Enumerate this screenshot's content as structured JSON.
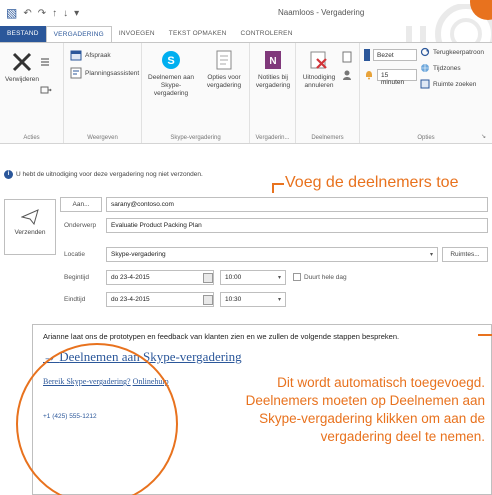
{
  "window": {
    "title": "Naamloos - Vergadering"
  },
  "qat": {
    "icons": [
      "save-icon",
      "undo-icon",
      "redo-icon",
      "up-icon",
      "down-icon",
      "customize-icon"
    ]
  },
  "tabs": [
    {
      "label": "BESTAND",
      "active": false
    },
    {
      "label": "VERGADERING",
      "active": true
    },
    {
      "label": "INVOEGEN",
      "active": false
    },
    {
      "label": "TEKST OPMAKEN",
      "active": false
    },
    {
      "label": "CONTROLEREN",
      "active": false
    }
  ],
  "ribbon": {
    "acties": {
      "label": "Acties",
      "delete": "Verwijderen"
    },
    "weergeven": {
      "label": "Weergeven",
      "afspraak": "Afspraak",
      "planning": "Planningsassistent"
    },
    "skype": {
      "label": "Skype-vergadering",
      "join": "Deelnemen aan Skype-vergadering",
      "options": "Opties voor vergadering"
    },
    "notes": {
      "label": "Vergaderin...",
      "notes": "Notities bij vergadering"
    },
    "attendees": {
      "label": "Deelnemers",
      "cancel": "Uitnodiging annuleren"
    },
    "options": {
      "label": "Opties",
      "busy": "Bezet",
      "reminder": "15 minuten",
      "recurrence": "Terugkeerpatroon",
      "timezones": "Tijdzones",
      "rooms": "Ruimte zoeken"
    }
  },
  "info": {
    "text": "U hebt de uitnodiging voor deze vergadering nog niet verzonden."
  },
  "form": {
    "send_label": "Verzenden",
    "to_button": "Aan...",
    "to_value": "sarany@contoso.com",
    "subject_label": "Onderwerp",
    "subject_value": "Evaluatie Product Packing Plan",
    "location_label": "Locatie",
    "location_value": "Skype-vergadering",
    "rooms_button": "Ruimtes...",
    "start_label": "Begintijd",
    "start_date": "do 23-4-2015",
    "start_time": "10:00",
    "allday_label": "Duurt hele dag",
    "end_label": "Eindtijd",
    "end_date": "do 23-4-2015",
    "end_time": "10:30"
  },
  "body": {
    "text": "Arianne laat ons de prototypen en feedback van klanten zien en we zullen de volgende stappen bespreken.",
    "join_link": "Deelnemen aan Skype-vergadering",
    "skype_question": "Bereik Skype-vergadering?",
    "skype_link": "Onlinehulp",
    "phone": "+1 (425) 555-1212"
  },
  "callouts": {
    "attendees": "Voeg de deelnemers toe",
    "auto": "Dit wordt automatisch toegevoegd. Deelnemers moeten op Deelnemen aan Skype-vergadering klikken om aan de vergadering deel te nemen."
  },
  "colors": {
    "accent": "#e8721e",
    "office_blue": "#2b579a",
    "skype_blue": "#00aff0",
    "onenote_purple": "#80397b"
  }
}
